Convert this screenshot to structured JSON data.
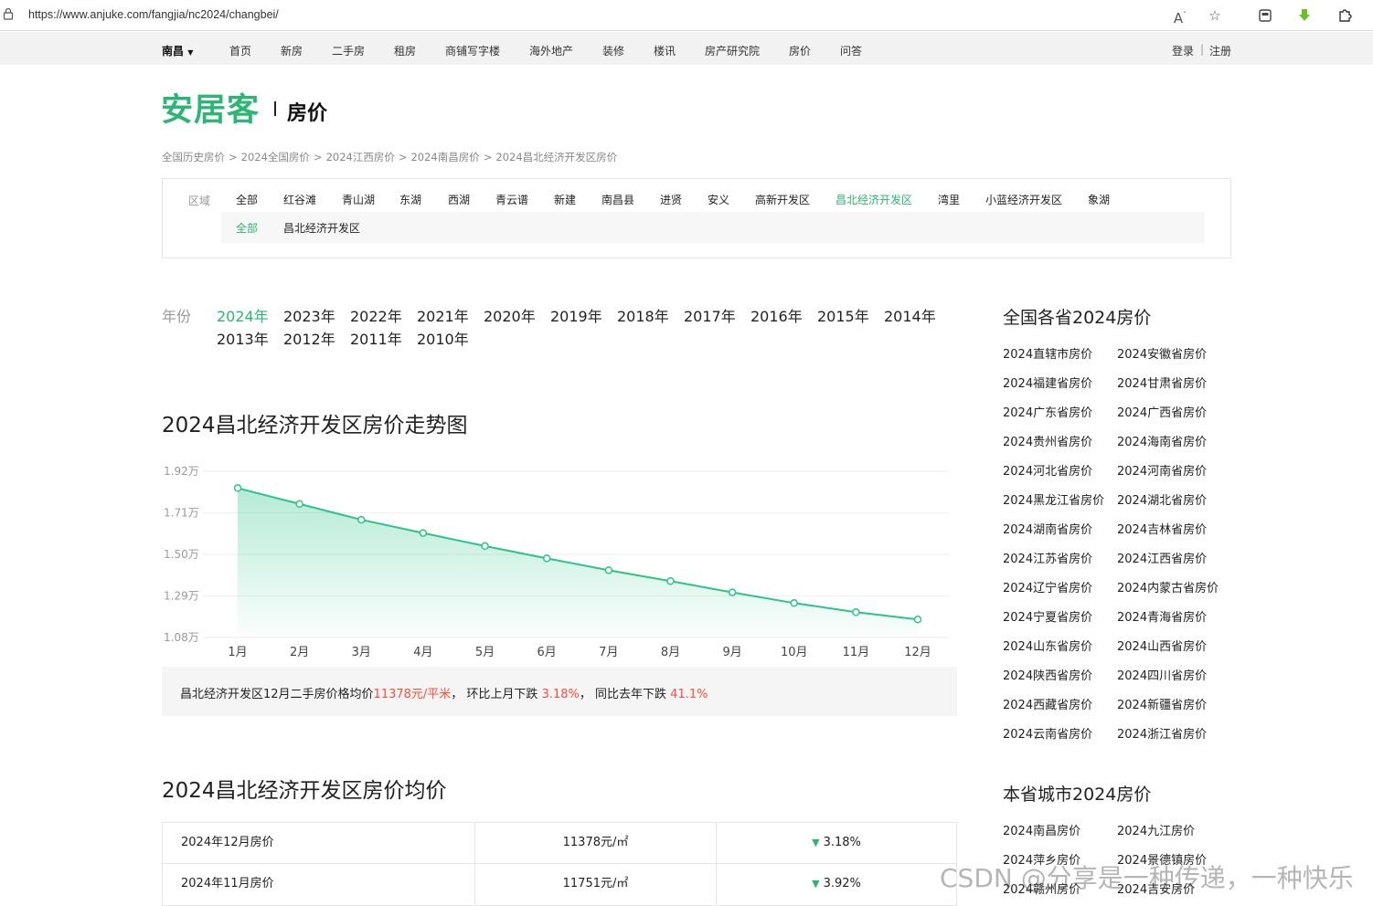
{
  "browser": {
    "url": "https://www.anjuke.com/fangjia/nc2024/changbei/",
    "icons": [
      "lock-icon",
      "read-aloud-icon",
      "favorite-star-icon",
      "collections-icon",
      "download-arrow-icon",
      "extensions-puzzle-icon"
    ]
  },
  "topnav": {
    "city": "南昌",
    "items": [
      "首页",
      "新房",
      "二手房",
      "租房",
      "商铺写字楼",
      "海外地产",
      "装修",
      "楼讯",
      "房产研究院",
      "房价",
      "问答"
    ],
    "login": "登录",
    "divider": "|",
    "register": "注册"
  },
  "logo": {
    "brand": "安居客",
    "sub": "房价"
  },
  "breadcrumb": {
    "items": [
      "全国历史房价",
      "2024全国房价",
      "2024江西房价",
      "2024南昌房价",
      "2024昌北经济开发区房价"
    ],
    "sep": ">"
  },
  "region": {
    "label": "区域",
    "items": [
      "全部",
      "红谷滩",
      "青山湖",
      "东湖",
      "西湖",
      "青云谱",
      "新建",
      "南昌县",
      "进贤",
      "安义",
      "高新开发区",
      "昌北经济开发区",
      "湾里",
      "小蓝经济开发区",
      "象湖"
    ],
    "active": "昌北经济开发区",
    "sub_items": [
      "全部",
      "昌北经济开发区"
    ],
    "sub_active": "全部"
  },
  "years": {
    "label": "年份",
    "items": [
      "2024年",
      "2023年",
      "2022年",
      "2021年",
      "2020年",
      "2019年",
      "2018年",
      "2017年",
      "2016年",
      "2015年",
      "2014年",
      "2013年",
      "2012年",
      "2011年",
      "2010年"
    ],
    "active": "2024年"
  },
  "chart_title": "2024昌北经济开发区房价走势图",
  "chart_data": {
    "type": "area",
    "categories": [
      "1月",
      "2月",
      "3月",
      "4月",
      "5月",
      "6月",
      "7月",
      "8月",
      "9月",
      "10月",
      "11月",
      "12月"
    ],
    "values": [
      18350,
      17550,
      16750,
      16080,
      15420,
      14800,
      14200,
      13650,
      13080,
      12540,
      12080,
      11710
    ],
    "y_tick_labels": [
      "1.92万",
      "1.71万",
      "1.50万",
      "1.29万",
      "1.08万"
    ],
    "y_ticks": [
      19200,
      17100,
      15000,
      12900,
      10800
    ],
    "ylim": [
      10800,
      19200
    ],
    "grid": true,
    "color": "#2bc48a"
  },
  "summary": {
    "prefix": "昌北经济开发区12月二手房价格均价",
    "price": "11378元/平米",
    "mid": "， 环比上月下跌",
    "mom": "3.18%",
    "mid2": "， 同比去年下跌",
    "yoy": "41.1%"
  },
  "avg_title": "2024昌北经济开发区房价均价",
  "avg_table": [
    {
      "month": "2024年12月房价",
      "price": "11378元/㎡",
      "change": "3.18%"
    },
    {
      "month": "2024年11月房价",
      "price": "11751元/㎡",
      "change": "3.92%"
    }
  ],
  "down_symbol": "▼",
  "sidebar": {
    "provinces_title": "全国各省2024房价",
    "provinces": [
      [
        "2024直辖市房价",
        "2024安徽省房价"
      ],
      [
        "2024福建省房价",
        "2024甘肃省房价"
      ],
      [
        "2024广东省房价",
        "2024广西省房价"
      ],
      [
        "2024贵州省房价",
        "2024海南省房价"
      ],
      [
        "2024河北省房价",
        "2024河南省房价"
      ],
      [
        "2024黑龙江省房价",
        "2024湖北省房价"
      ],
      [
        "2024湖南省房价",
        "2024吉林省房价"
      ],
      [
        "2024江苏省房价",
        "2024江西省房价"
      ],
      [
        "2024辽宁省房价",
        "2024内蒙古省房价"
      ],
      [
        "2024宁夏省房价",
        "2024青海省房价"
      ],
      [
        "2024山东省房价",
        "2024山西省房价"
      ],
      [
        "2024陕西省房价",
        "2024四川省房价"
      ],
      [
        "2024西藏省房价",
        "2024新疆省房价"
      ],
      [
        "2024云南省房价",
        "2024浙江省房价"
      ]
    ],
    "cities_title": "本省城市2024房价",
    "cities": [
      [
        "2024南昌房价",
        "2024九江房价"
      ],
      [
        "2024萍乡房价",
        "2024景德镇房价"
      ],
      [
        "2024赣州房价",
        "2024吉安房价"
      ]
    ]
  },
  "watermark": "CSDN @分享是一种传递，一种快乐"
}
